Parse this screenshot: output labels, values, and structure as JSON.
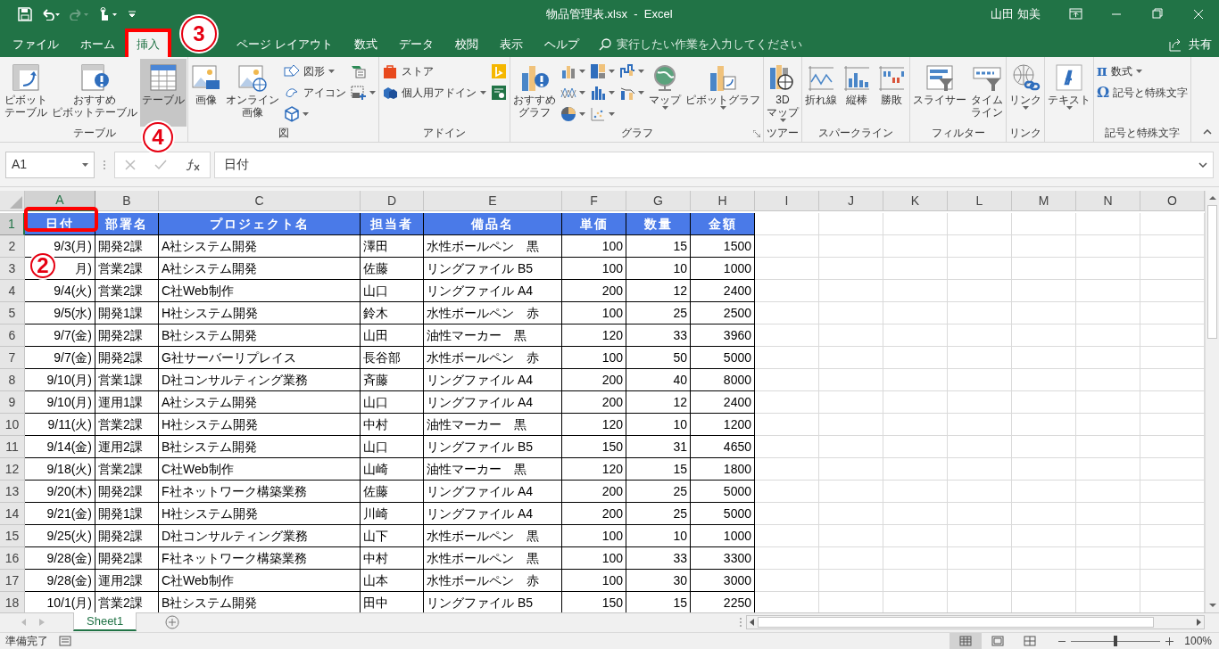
{
  "title_bar": {
    "title": "物品管理表.xlsx  -  Excel",
    "user": "山田 知美"
  },
  "tabs": [
    {
      "label": "ファイル",
      "selected": false
    },
    {
      "label": "ホーム",
      "selected": false
    },
    {
      "label": "挿入",
      "selected": true
    },
    {
      "label": "ページ レイアウト",
      "selected": false
    },
    {
      "label": "数式",
      "selected": false
    },
    {
      "label": "データ",
      "selected": false
    },
    {
      "label": "校閲",
      "selected": false
    },
    {
      "label": "表示",
      "selected": false
    },
    {
      "label": "ヘルプ",
      "selected": false
    }
  ],
  "tell_me": {
    "placeholder": "実行したい作業を入力してください"
  },
  "share": "共有",
  "ribbon": {
    "groups": [
      {
        "label": "テーブル",
        "columns": [
          [
            {
              "kind": "large",
              "label": "ピボットテーブル",
              "dropdown": false,
              "pressed": false
            }
          ],
          [
            {
              "kind": "large",
              "label": "おすすめピボットテーブル",
              "dropdown": false,
              "pressed": false
            }
          ],
          [
            {
              "kind": "large",
              "label": "テーブル",
              "dropdown": false,
              "pressed": true
            }
          ]
        ]
      },
      {
        "label": "図",
        "columns": [
          [
            {
              "kind": "large",
              "label": "画像",
              "dropdown": false
            }
          ],
          [
            {
              "kind": "large",
              "label": "オンライン画像",
              "dropdown": false
            }
          ],
          [
            {
              "kind": "small",
              "label": "図形",
              "dropdown": true
            },
            {
              "kind": "small",
              "label": "アイコン",
              "dropdown": false
            },
            {
              "kind": "icon",
              "dropdown": true
            }
          ],
          [
            {
              "kind": "icon",
              "dropdown": false
            },
            {
              "kind": "icon",
              "dropdown": true
            }
          ]
        ]
      },
      {
        "label": "アドイン",
        "columns": [
          [
            {
              "kind": "small",
              "label": "ストア",
              "dropdown": false
            },
            {
              "kind": "small",
              "label": "個人用アドイン",
              "dropdown": true
            }
          ],
          [
            {
              "kind": "icon",
              "dropdown": false
            },
            {
              "kind": "icon",
              "dropdown": false
            }
          ]
        ]
      },
      {
        "label": "グラフ",
        "launcher": true,
        "columns": [
          [
            {
              "kind": "large",
              "label": "おすすめグラフ",
              "dropdown": false
            }
          ],
          [
            {
              "kind": "icon",
              "dropdown": true
            },
            {
              "kind": "icon",
              "dropdown": true
            },
            {
              "kind": "icon",
              "dropdown": true
            }
          ],
          [
            {
              "kind": "icon",
              "dropdown": true
            },
            {
              "kind": "icon",
              "dropdown": true
            },
            {
              "kind": "icon",
              "dropdown": true
            }
          ],
          [
            {
              "kind": "icon",
              "dropdown": true
            },
            {
              "kind": "icon",
              "dropdown": true
            }
          ],
          [
            {
              "kind": "large",
              "label": "マップ",
              "dropdown": true
            }
          ],
          [
            {
              "kind": "large",
              "label": "ピボットグラフ",
              "dropdown": true
            }
          ]
        ]
      },
      {
        "label": "ツアー",
        "columns": [
          [
            {
              "kind": "large",
              "label": "3Dマップ",
              "dropdown": true
            }
          ]
        ]
      },
      {
        "label": "スパークライン",
        "columns": [
          [
            {
              "kind": "large",
              "label": "折れ線",
              "dropdown": false
            }
          ],
          [
            {
              "kind": "large",
              "label": "縦棒",
              "dropdown": false
            }
          ],
          [
            {
              "kind": "large",
              "label": "勝敗",
              "dropdown": false
            }
          ]
        ]
      },
      {
        "label": "フィルター",
        "columns": [
          [
            {
              "kind": "large",
              "label": "スライサー",
              "dropdown": false
            }
          ],
          [
            {
              "kind": "large",
              "label": "タイムライン",
              "dropdown": false
            }
          ]
        ]
      },
      {
        "label": "リンク",
        "columns": [
          [
            {
              "kind": "large",
              "label": "リンク",
              "dropdown": true
            }
          ]
        ]
      },
      {
        "columns": [
          [
            {
              "kind": "large",
              "label": "テキスト",
              "dropdown": true
            }
          ]
        ]
      },
      {
        "label": "記号と特殊文字",
        "columns": [
          [
            {
              "kind": "small",
              "glyph": "π",
              "label": "数式",
              "dropdown": true
            },
            {
              "kind": "small",
              "glyph": "Ω",
              "label": "記号と特殊文字",
              "dropdown": false
            }
          ]
        ]
      }
    ]
  },
  "formula_bar": {
    "name_box": "A1",
    "value": "日付"
  },
  "sheet": {
    "columns": [
      {
        "label": "A",
        "selected": true
      },
      {
        "label": "B",
        "selected": false
      },
      {
        "label": "C",
        "selected": false
      },
      {
        "label": "D",
        "selected": false
      },
      {
        "label": "E",
        "selected": false
      },
      {
        "label": "F",
        "selected": false
      },
      {
        "label": "G",
        "selected": false
      },
      {
        "label": "H",
        "selected": false
      },
      {
        "label": "I",
        "selected": false
      },
      {
        "label": "J",
        "selected": false
      },
      {
        "label": "K",
        "selected": false
      },
      {
        "label": "L",
        "selected": false
      },
      {
        "label": "M",
        "selected": false
      },
      {
        "label": "N",
        "selected": false
      },
      {
        "label": "O",
        "selected": false
      }
    ],
    "rows": [
      {
        "number": "1",
        "selected": true,
        "kind": "header",
        "cells": [
          "日付",
          "部署名",
          "プロジェクト名",
          "担当者",
          "備品名",
          "単価",
          "数量",
          "金額"
        ]
      },
      {
        "number": "2",
        "selected": false,
        "kind": "data",
        "cells": [
          "9/3(月)",
          "開発2課",
          "A社システム開発",
          "澤田",
          "水性ボールペン　黒",
          "100",
          "15",
          "1500"
        ]
      },
      {
        "number": "3",
        "selected": false,
        "kind": "data",
        "cells": [
          "月)",
          "営業2課",
          "A社システム開発",
          "佐藤",
          "リングファイル B5",
          "100",
          "10",
          "1000"
        ]
      },
      {
        "number": "4",
        "selected": false,
        "kind": "data",
        "cells": [
          "9/4(火)",
          "営業2課",
          "C社Web制作",
          "山口",
          "リングファイル A4",
          "200",
          "12",
          "2400"
        ]
      },
      {
        "number": "5",
        "selected": false,
        "kind": "data",
        "cells": [
          "9/5(水)",
          "開発1課",
          "H社システム開発",
          "鈴木",
          "水性ボールペン　赤",
          "100",
          "25",
          "2500"
        ]
      },
      {
        "number": "6",
        "selected": false,
        "kind": "data",
        "cells": [
          "9/7(金)",
          "開発2課",
          "B社システム開発",
          "山田",
          "油性マーカー　黒",
          "120",
          "33",
          "3960"
        ]
      },
      {
        "number": "7",
        "selected": false,
        "kind": "data",
        "cells": [
          "9/7(金)",
          "開発2課",
          "G社サーバーリプレイス",
          "長谷部",
          "水性ボールペン　赤",
          "100",
          "50",
          "5000"
        ]
      },
      {
        "number": "8",
        "selected": false,
        "kind": "data",
        "cells": [
          "9/10(月)",
          "営業1課",
          "D社コンサルティング業務",
          "斉藤",
          "リングファイル A4",
          "200",
          "40",
          "8000"
        ]
      },
      {
        "number": "9",
        "selected": false,
        "kind": "data",
        "cells": [
          "9/10(月)",
          "運用1課",
          "A社システム開発",
          "山口",
          "リングファイル A4",
          "200",
          "12",
          "2400"
        ]
      },
      {
        "number": "10",
        "selected": false,
        "kind": "data",
        "cells": [
          "9/11(火)",
          "営業2課",
          "H社システム開発",
          "中村",
          "油性マーカー　黒",
          "120",
          "10",
          "1200"
        ]
      },
      {
        "number": "11",
        "selected": false,
        "kind": "data",
        "cells": [
          "9/14(金)",
          "運用2課",
          "B社システム開発",
          "山口",
          "リングファイル B5",
          "150",
          "31",
          "4650"
        ]
      },
      {
        "number": "12",
        "selected": false,
        "kind": "data",
        "cells": [
          "9/18(火)",
          "営業2課",
          "C社Web制作",
          "山崎",
          "油性マーカー　黒",
          "120",
          "15",
          "1800"
        ]
      },
      {
        "number": "13",
        "selected": false,
        "kind": "data",
        "cells": [
          "9/20(木)",
          "開発2課",
          "F社ネットワーク構築業務",
          "佐藤",
          "リングファイル A4",
          "200",
          "25",
          "5000"
        ]
      },
      {
        "number": "14",
        "selected": false,
        "kind": "data",
        "cells": [
          "9/21(金)",
          "開発1課",
          "H社システム開発",
          "川崎",
          "リングファイル A4",
          "200",
          "25",
          "5000"
        ]
      },
      {
        "number": "15",
        "selected": false,
        "kind": "data",
        "cells": [
          "9/25(火)",
          "開発2課",
          "D社コンサルティング業務",
          "山下",
          "水性ボールペン　黒",
          "100",
          "10",
          "1000"
        ]
      },
      {
        "number": "16",
        "selected": false,
        "kind": "data",
        "cells": [
          "9/28(金)",
          "開発2課",
          "F社ネットワーク構築業務",
          "中村",
          "水性ボールペン　黒",
          "100",
          "33",
          "3300"
        ]
      },
      {
        "number": "17",
        "selected": false,
        "kind": "data",
        "cells": [
          "9/28(金)",
          "運用2課",
          "C社Web制作",
          "山本",
          "水性ボールペン　赤",
          "100",
          "30",
          "3000"
        ]
      },
      {
        "number": "18",
        "selected": false,
        "kind": "data",
        "cells": [
          "10/1(月)",
          "営業2課",
          "B社システム開発",
          "田中",
          "リングファイル B5",
          "150",
          "15",
          "2250"
        ]
      }
    ]
  },
  "sheet_tabs": [
    {
      "label": "Sheet1",
      "selected": true
    }
  ],
  "status_bar": {
    "status": "準備完了",
    "views": [
      {
        "selected": true
      },
      {
        "selected": false
      },
      {
        "selected": false
      }
    ],
    "zoom": {
      "level": 0.5
    },
    "zoom_label": "100%"
  },
  "annotations": [
    {
      "number": "3"
    },
    {
      "number": "4"
    },
    {
      "number": "2"
    }
  ]
}
